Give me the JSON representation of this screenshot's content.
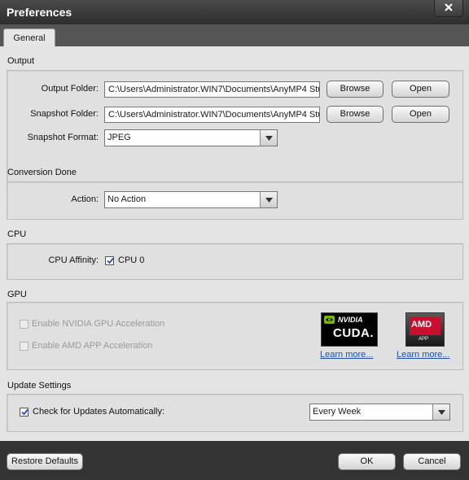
{
  "window": {
    "title": "Preferences",
    "close_icon": "close-icon"
  },
  "tabs": [
    {
      "label": "General",
      "selected": true
    }
  ],
  "output": {
    "section_title": "Output",
    "output_folder_label": "Output Folder:",
    "output_folder_value": "C:\\Users\\Administrator.WIN7\\Documents\\AnyMP4 Stu",
    "snapshot_folder_label": "Snapshot Folder:",
    "snapshot_folder_value": "C:\\Users\\Administrator.WIN7\\Documents\\AnyMP4 Stu",
    "browse_label": "Browse",
    "open_label": "Open",
    "snapshot_format_label": "Snapshot Format:",
    "snapshot_format_value": "JPEG"
  },
  "conversion_done": {
    "section_title": "Conversion Done",
    "action_label": "Action:",
    "action_value": "No Action"
  },
  "cpu": {
    "section_title": "CPU",
    "affinity_label": "CPU Affinity:",
    "cpu0_label": "CPU 0",
    "cpu0_checked": true
  },
  "gpu": {
    "section_title": "GPU",
    "nvidia_label": "Enable NVIDIA GPU Acceleration",
    "nvidia_checked": false,
    "amd_label": "Enable AMD APP Acceleration",
    "amd_checked": false,
    "nvidia_logo_brand": "NVIDIA",
    "nvidia_logo_product": "CUDA.",
    "amd_logo_brand": "AMD",
    "amd_logo_product": "APP",
    "learn_more_label": "Learn more...",
    "nvidia_color": "#76b900",
    "amd_color": "#c8102e"
  },
  "update_settings": {
    "section_title": "Update Settings",
    "check_label": "Check for Updates Automatically:",
    "check_checked": true,
    "frequency_value": "Every Week"
  },
  "footer": {
    "restore_label": "Restore Defaults",
    "ok_label": "OK",
    "cancel_label": "Cancel"
  }
}
